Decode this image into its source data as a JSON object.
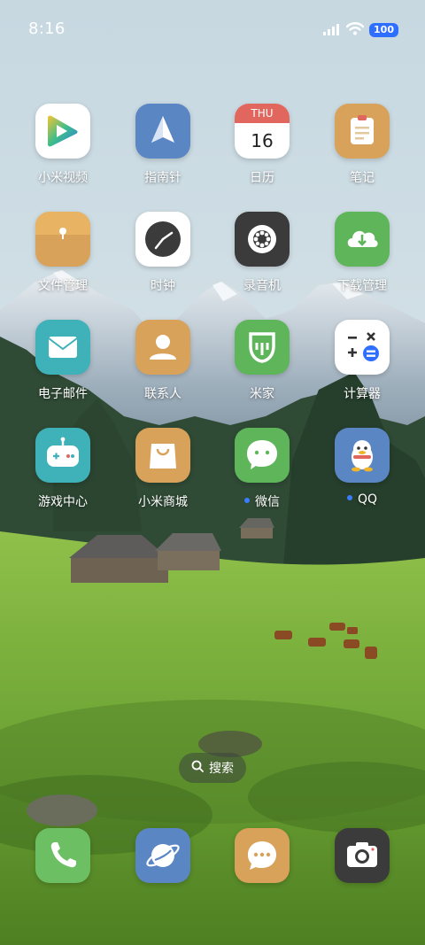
{
  "status_bar": {
    "time": "8:16",
    "battery_level": "100",
    "signal_icon": "cellular-signal-icon",
    "wifi_icon": "wifi-icon"
  },
  "apps": [
    {
      "label": "小米视频",
      "icon": "video-play-icon",
      "color": "#ffffff"
    },
    {
      "label": "指南针",
      "icon": "compass-needle-icon",
      "color": "#5b86c4"
    },
    {
      "label": "日历",
      "icon": "calendar-icon",
      "color": "#ffffff",
      "calendar_day": "THU",
      "calendar_date": "16"
    },
    {
      "label": "笔记",
      "icon": "notes-icon",
      "color": "#d9a25a"
    },
    {
      "label": "文件管理",
      "icon": "folder-icon",
      "color": "#d9a25a"
    },
    {
      "label": "时钟",
      "icon": "clock-icon",
      "color": "#ffffff"
    },
    {
      "label": "录音机",
      "icon": "recorder-icon",
      "color": "#3b3b3b"
    },
    {
      "label": "下载管理",
      "icon": "cloud-download-icon",
      "color": "#5fb55a"
    },
    {
      "label": "电子邮件",
      "icon": "mail-icon",
      "color": "#3fb1b8"
    },
    {
      "label": "联系人",
      "icon": "contact-person-icon",
      "color": "#d9a25a"
    },
    {
      "label": "米家",
      "icon": "mijia-icon",
      "color": "#5fb55a"
    },
    {
      "label": "计算器",
      "icon": "calculator-icon",
      "color": "#ffffff"
    },
    {
      "label": "游戏中心",
      "icon": "game-controller-icon",
      "color": "#3fb1b8"
    },
    {
      "label": "小米商城",
      "icon": "shopping-bag-icon",
      "color": "#d9a25a"
    },
    {
      "label": "微信",
      "icon": "wechat-icon",
      "color": "#5fb55a",
      "new": true
    },
    {
      "label": "QQ",
      "icon": "qq-penguin-icon",
      "color": "#5b86c4",
      "new": true
    }
  ],
  "search": {
    "label": "搜索"
  },
  "dock": [
    {
      "icon": "phone-icon",
      "color": "#6cc063"
    },
    {
      "icon": "browser-planet-icon",
      "color": "#5b86c4"
    },
    {
      "icon": "messages-icon",
      "color": "#d9a25a"
    },
    {
      "icon": "camera-icon",
      "color": "#3b3b3b"
    }
  ]
}
